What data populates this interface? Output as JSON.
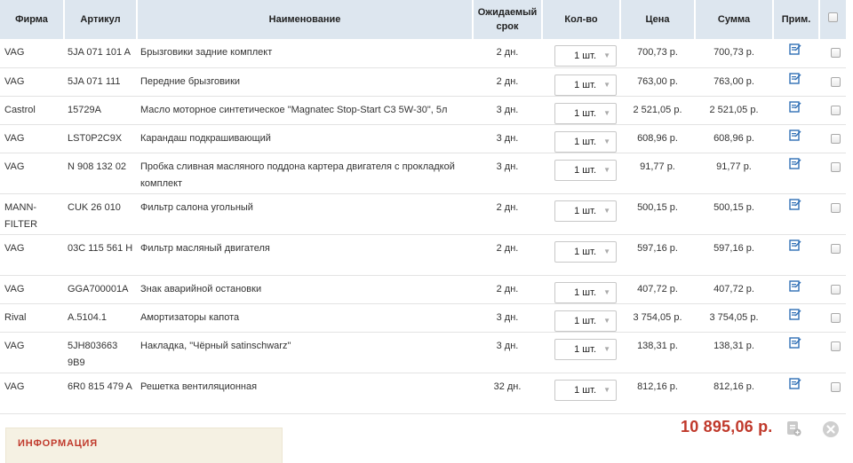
{
  "headers": {
    "firm": "Фирма",
    "article": "Артикул",
    "name": "Наименование",
    "expected_line1": "Ожидаемый",
    "expected_line2": "срок",
    "qty": "Кол-во",
    "price": "Цена",
    "sum": "Сумма",
    "note": "Прим."
  },
  "rows": [
    {
      "firm": "VAG",
      "article": "5JA 071 101 A",
      "name": "Брызговики задние комплект",
      "date": "2 дн.",
      "qty": "1 шт.",
      "price": "700,73 р.",
      "sum": "700,73 р."
    },
    {
      "firm": "VAG",
      "article": "5JA 071 111",
      "name": "Передние брызговики",
      "date": "2 дн.",
      "qty": "1 шт.",
      "price": "763,00 р.",
      "sum": "763,00 р."
    },
    {
      "firm": "Castrol",
      "article": "15729A",
      "name": "Масло моторное синтетическое \"Magnatec Stop-Start C3 5W-30\", 5л",
      "date": "3 дн.",
      "qty": "1 шт.",
      "price": "2 521,05 р.",
      "sum": "2 521,05 р."
    },
    {
      "firm": "VAG",
      "article": "LST0P2C9X",
      "name": "Карандаш подкрашивающий",
      "date": "3 дн.",
      "qty": "1 шт.",
      "price": "608,96 р.",
      "sum": "608,96 р."
    },
    {
      "firm": "VAG",
      "article": "N 908 132 02",
      "name": "Пробка сливная масляного поддона картера двигателя с прокладкой комплект",
      "date": "3 дн.",
      "qty": "1 шт.",
      "price": "91,77 р.",
      "sum": "91,77 р."
    },
    {
      "firm": "MANN-FILTER",
      "article": "CUK 26 010",
      "name": "Фильтр салона угольный",
      "date": "2 дн.",
      "qty": "1 шт.",
      "price": "500,15 р.",
      "sum": "500,15 р."
    },
    {
      "firm": "VAG",
      "article": "03C 115 561 H",
      "name": "Фильтр масляный двигателя",
      "date": "2 дн.",
      "qty": "1 шт.",
      "price": "597,16 р.",
      "sum": "597,16 р."
    },
    {
      "firm": "VAG",
      "article": "GGA700001A",
      "name": "Знак аварийной остановки",
      "date": "2 дн.",
      "qty": "1 шт.",
      "price": "407,72 р.",
      "sum": "407,72 р."
    },
    {
      "firm": "Rival",
      "article": "A.5104.1",
      "name": "Амортизаторы капота",
      "date": "3 дн.",
      "qty": "1 шт.",
      "price": "3 754,05 р.",
      "sum": "3 754,05 р."
    },
    {
      "firm": "VAG",
      "article": "5JH803663 9B9",
      "name": "Накладка, \"Чёрный satinschwarz\"",
      "date": "3 дн.",
      "qty": "1 шт.",
      "price": "138,31 р.",
      "sum": "138,31 р."
    },
    {
      "firm": "VAG",
      "article": "6R0 815 479 A",
      "name": "Решетка вентиляционная",
      "date": "32 дн.",
      "qty": "1 шт.",
      "price": "812,16 р.",
      "sum": "812,16 р."
    }
  ],
  "total": "10 895,06 р.",
  "info_title": "ИНФОРМАЦИЯ",
  "icons": {
    "note": "edit-note-icon",
    "add": "add-document-icon",
    "close": "close-icon",
    "qty_arrow": "dropdown-arrow-icon"
  },
  "colors": {
    "header_bg": "#dde6ef",
    "accent_red": "#c0392b",
    "note_icon": "#2f6fb5",
    "info_bg": "#f5f1e3"
  }
}
